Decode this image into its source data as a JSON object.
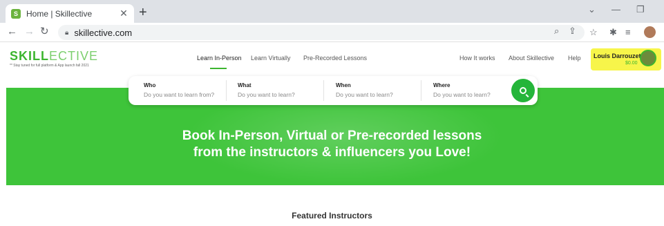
{
  "browser": {
    "tab_title": "Home | Skillective",
    "favicon_letter": "S",
    "url": "skillective.com",
    "icons": [
      "back-icon",
      "forward-icon",
      "reload-icon",
      "lock-icon",
      "zoom-icon",
      "share-icon",
      "star-icon",
      "extensions-icon",
      "reading-list-icon",
      "profile-icon"
    ]
  },
  "site": {
    "logo_bold": "SKILL",
    "logo_thin": "ECTIVE",
    "tagline": "** Stay tuned for full platform & App launch fall 2021",
    "nav_left": [
      {
        "label": "Learn In-Person"
      },
      {
        "label": "Learn Virtually"
      },
      {
        "label": "Pre-Recorded Lessons"
      }
    ],
    "nav_right": [
      {
        "label": "How It works"
      },
      {
        "label": "About Skillective"
      },
      {
        "label": "Help"
      }
    ],
    "user": {
      "name": "Louis Darrouzet",
      "balance": "$0.00"
    },
    "accent_color": "#3cb52f",
    "highlight_color": "#f7f54a"
  },
  "search": {
    "fields": [
      {
        "label": "Who",
        "placeholder": "Do you want to learn from?"
      },
      {
        "label": "What",
        "placeholder": "Do you want to learn?"
      },
      {
        "label": "When",
        "placeholder": "Do you want to learn?"
      },
      {
        "label": "Where",
        "placeholder": "Do you want to learn?"
      }
    ]
  },
  "hero": {
    "line1": "Book In-Person, Virtual or Pre-recorded lessons",
    "line2": "from the instructors & influencers you Love!"
  },
  "sections": {
    "featured_title": "Featured Instructors"
  }
}
